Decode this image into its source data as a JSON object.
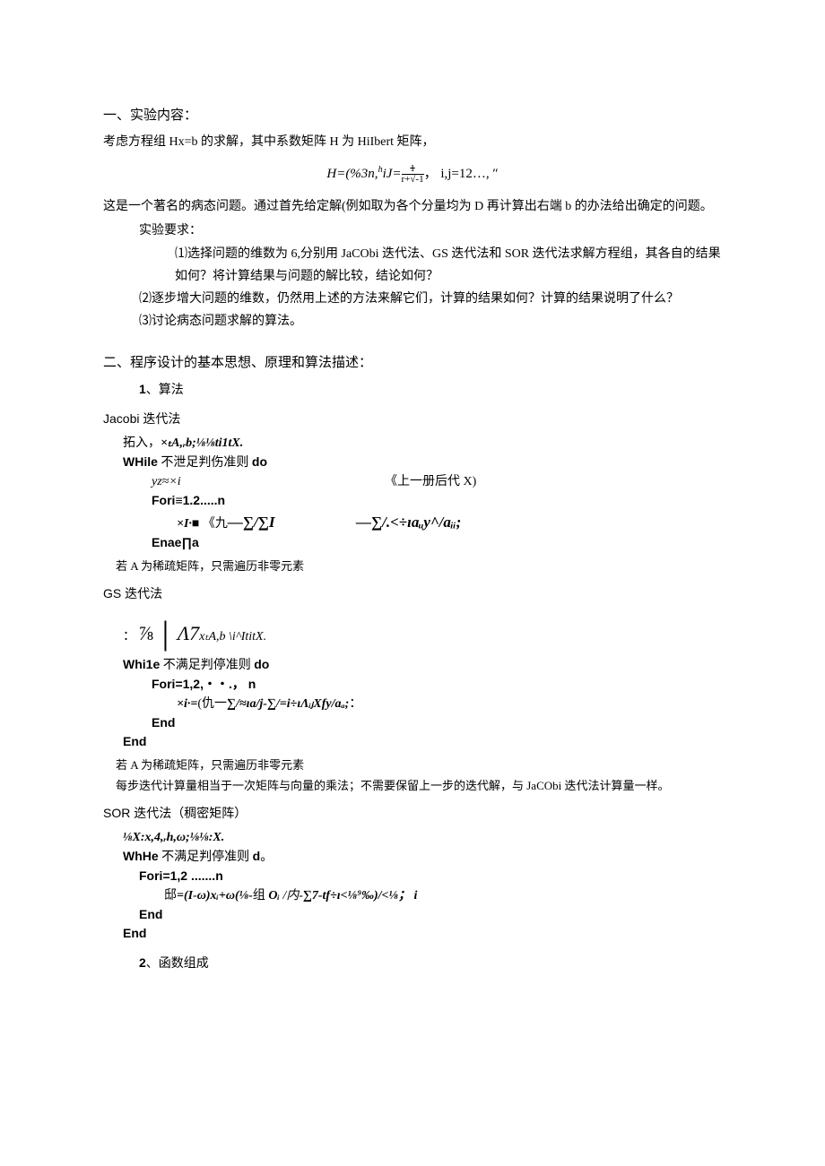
{
  "s1": {
    "title": "一、实验内容：",
    "p1": "考虑方程组 Hx=b 的求解，其中系数矩阵 H 为 HiIbert 矩阵，",
    "formula_left": "H=(%3n,",
    "formula_sup": "h",
    "formula_mid": "iJ=",
    "formula_frac_top": "1",
    "formula_frac_bot": "r+√-1",
    "formula_right": "，  i,j=12…,  ″",
    "p2": "这是一个著名的病态问题。通过首先给定解(例如取为各个分量均为 D 再计算出右端 b 的办法给出确定的问题。",
    "req_title": "实验要求：",
    "req1": "⑴选择问题的维数为 6,分别用 JaCObi 迭代法、GS 迭代法和 SOR 迭代法求解方程组，其各自的结果如何？将计算结果与问题的解比较，结论如何？",
    "req2": "⑵逐步增大问题的维数，仍然用上述的方法来解它们，计算的结果如何？计算的结果说明了什么？",
    "req3": "⑶讨论病态问题求解的算法。"
  },
  "s2": {
    "title": "二、程序设计的基本思想、原理和算法描述：",
    "sub1_num": "1",
    "sub1_label": "、算法",
    "jacobi": {
      "title": "Jacobi 迭代法",
      "l1a": "拓入，",
      "l1b": "×ₜA,ᵣb;⅛⅛ti1tX.",
      "l2a": "WHile",
      "l2b": " 不泄足判伤准则 ",
      "l2c": "do",
      "l3a": "yz≈×i",
      "l3b": "《上一册后代 X)",
      "l4": "Fori≡1.2.....n",
      "l5a": "×I·■",
      "l5b": "《九",
      "l5c": "—∑/∑I",
      "l5d": "—∑/.<÷ıaᵤy^/aᵢᵢ;",
      "l6": "Enae∏a",
      "note": "若 A 为稀疏矩阵，只需遍历非零元素"
    },
    "gs": {
      "title": "GS 迭代法",
      "l1a": "：",
      "l1b": "⅞",
      "l1c": "│",
      "l1d": "Λ7",
      "l1e": "xₜA,b \\i^ItitX.",
      "l2a": "Whi1e",
      "l2b": " 不满足判停准则 ",
      "l2c": "do",
      "l3": "Fori=1,2,・・.， n",
      "l4a": "×i·=",
      "l4b": "(仇一",
      "l4c": "∑/≈ıa/j-∑/=i÷ıΛᵢⱼXfy/aₐ;",
      "l4d": "：",
      "l5": "End",
      "l6": "End",
      "note1": "若 A 为稀疏矩阵，只需遍历非零元素",
      "note2": "每步迭代计算量相当于一次矩阵与向量的乘法；不需要保留上一步的迭代解，与 JaCObi 迭代法计算量一样。"
    },
    "sor": {
      "title": "SOR 迭代法（稠密矩阵）",
      "l1": "⅛X:x,4,ᵣh,ω;⅛⅛:X.",
      "l2a": "WhHe",
      "l2b": " 不满足判停准则 ",
      "l2c": "d",
      "l2d": "。",
      "l3": "Fori=1,2 .......n",
      "l4a": "邸",
      "l4b": "=(I-ω)xᵢ+ω(⅛-",
      "l4c": "组 ",
      "l4d": "Oᵢ ",
      "l4e": "/内-",
      "l4f": "∑7-tf÷ı<⅛⁹‰)/<⅛；  i",
      "l5": "End",
      "l6": "End"
    },
    "sub2_num": "2",
    "sub2_label": "、函数组成"
  }
}
